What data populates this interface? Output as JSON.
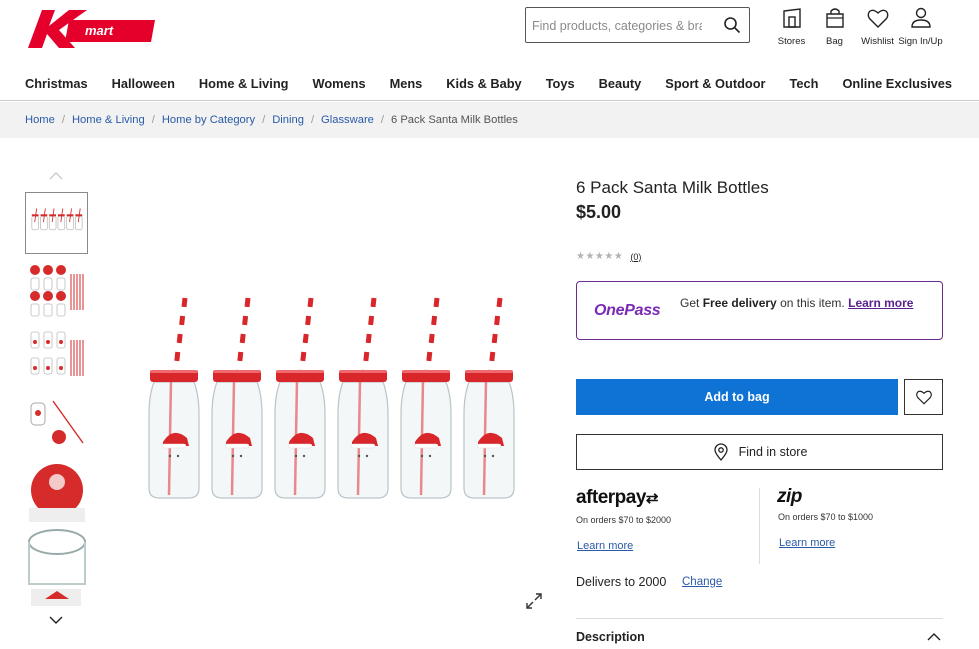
{
  "header": {
    "logo_text": "mart",
    "search_placeholder": "Find products, categories & brands",
    "icons": [
      {
        "name": "store-icon",
        "label": "Stores"
      },
      {
        "name": "bag-icon",
        "label": "Bag"
      },
      {
        "name": "heart-icon",
        "label": "Wishlist"
      },
      {
        "name": "user-icon",
        "label": "Sign In/Up"
      }
    ]
  },
  "nav": [
    "Christmas",
    "Halloween",
    "Home & Living",
    "Womens",
    "Mens",
    "Kids & Baby",
    "Toys",
    "Beauty",
    "Sport & Outdoor",
    "Tech",
    "Online Exclusives"
  ],
  "breadcrumb": [
    "Home",
    "Home & Living",
    "Home by Category",
    "Dining",
    "Glassware",
    "6 Pack Santa Milk Bottles"
  ],
  "product": {
    "title": "6 Pack Santa Milk Bottles",
    "price": "$5.00",
    "rating_stars": "★★★★★",
    "review_count": "(0)",
    "onepass": {
      "logo": "OnePass",
      "text_before": "Get ",
      "text_bold": "Free delivery",
      "text_after": " on this item. ",
      "link": "Learn more"
    },
    "add_to_bag": "Add to bag",
    "find_in_store": "Find in store",
    "afterpay": {
      "logo": "afterpay",
      "range": "On orders $70 to $2000",
      "link": "Learn more"
    },
    "zip": {
      "logo": "zip",
      "range": "On orders $70 to $1000",
      "link": "Learn more"
    },
    "delivery_text": "Delivers to 2000",
    "delivery_change": "Change",
    "description_label": "Description"
  },
  "colors": {
    "brand_red": "#e4002b",
    "primary_blue": "#0f73d6",
    "onepass_purple": "#6b2c8f",
    "link_blue": "#2a5aa8"
  }
}
